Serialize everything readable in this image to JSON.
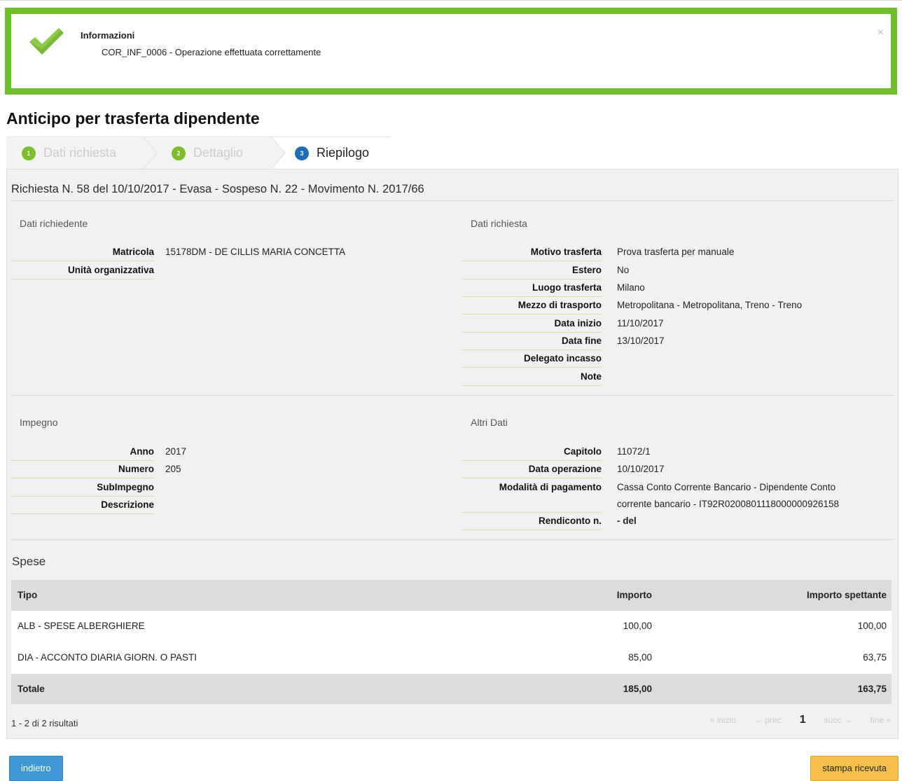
{
  "alert": {
    "title": "Informazioni",
    "message": "COR_INF_0006 - Operazione effettuata correttamente",
    "close": "×"
  },
  "page_title": "Anticipo per trasferta dipendente",
  "wizard": {
    "steps": [
      {
        "num": "1",
        "label": "Dati richiesta",
        "state": "done"
      },
      {
        "num": "2",
        "label": "Dettaglio",
        "state": "done"
      },
      {
        "num": "3",
        "label": "Riepilogo",
        "state": "active"
      }
    ]
  },
  "request_title": "Richiesta N. 58 del 10/10/2017 - Evasa - Sospeso N. 22 - Movimento N. 2017/66",
  "dati_richiedente": {
    "label": "Dati richiedente",
    "fields": [
      {
        "label": "Matricola",
        "value": "15178DM - DE CILLIS MARIA CONCETTA"
      },
      {
        "label": "Unità organizzativa",
        "value": ""
      }
    ]
  },
  "dati_richiesta": {
    "label": "Dati richiesta",
    "fields": [
      {
        "label": "Motivo trasferta",
        "value": "Prova trasferta per manuale"
      },
      {
        "label": "Estero",
        "value": "No"
      },
      {
        "label": "Luogo trasferta",
        "value": "Milano"
      },
      {
        "label": "Mezzo di trasporto",
        "value": "Metropolitana - Metropolitana,  Treno - Treno"
      },
      {
        "label": "Data inizio",
        "value": "11/10/2017"
      },
      {
        "label": "Data fine",
        "value": "13/10/2017"
      },
      {
        "label": "Delegato incasso",
        "value": ""
      },
      {
        "label": "Note",
        "value": ""
      }
    ]
  },
  "impegno": {
    "label": "Impegno",
    "fields": [
      {
        "label": "Anno",
        "value": "2017"
      },
      {
        "label": "Numero",
        "value": "205"
      },
      {
        "label": "SubImpegno",
        "value": ""
      },
      {
        "label": "Descrizione",
        "value": ""
      }
    ]
  },
  "altri_dati": {
    "label": "Altri Dati",
    "fields": [
      {
        "label": "Capitolo",
        "value": "11072/1"
      },
      {
        "label": "Data operazione",
        "value": "10/10/2017"
      },
      {
        "label": "Modalità di pagamento",
        "value": "Cassa Conto Corrente Bancario - Dipendente Conto",
        "value2": "corrente bancario - IT92R0200801118000000926158"
      },
      {
        "label": "Rendiconto n.",
        "value": "- del"
      }
    ]
  },
  "spese": {
    "title": "Spese",
    "headers": [
      "Tipo",
      "Importo",
      "Importo spettante"
    ],
    "rows": [
      [
        "ALB - SPESE ALBERGHIERE",
        "100,00",
        "100,00"
      ],
      [
        "DIA - ACCONTO DIARIA GIORN. O PASTI",
        "85,00",
        "63,75"
      ]
    ],
    "total": [
      "Totale",
      "185,00",
      "163,75"
    ],
    "results": "1 - 2 di 2 risultati",
    "pager": {
      "first": "« inizio",
      "prev": "← prec",
      "current": "1",
      "next": "succ →",
      "last": "fine »"
    }
  },
  "buttons": {
    "back": "indietro",
    "print": "stampa ricevuta"
  }
}
